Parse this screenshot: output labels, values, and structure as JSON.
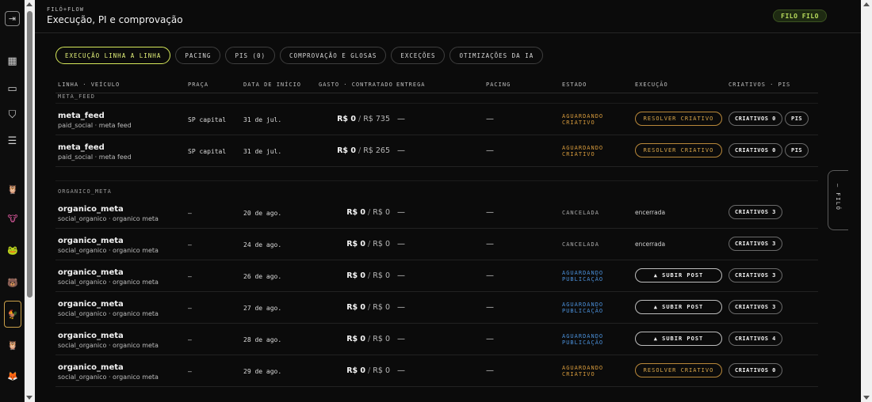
{
  "sidebar": {
    "toggle_icon": "panel-toggle-icon",
    "nav": [
      {
        "name": "grid-icon",
        "glyph": "▦"
      },
      {
        "name": "folder-icon",
        "glyph": "▭"
      },
      {
        "name": "shield-icon",
        "glyph": "⛉"
      },
      {
        "name": "list-icon",
        "glyph": "☰"
      }
    ],
    "avatars": [
      {
        "name": "owl-avatar-purple",
        "glyph": "🦉",
        "color": "#7a5de0"
      },
      {
        "name": "cow-avatar",
        "glyph": "🐮",
        "color": "#e05aa0"
      },
      {
        "name": "frog-avatar",
        "glyph": "🐸",
        "color": "#2aa160"
      },
      {
        "name": "bear-avatar",
        "glyph": "🐻",
        "color": "#d9452e"
      },
      {
        "name": "rooster-avatar",
        "glyph": "🐓",
        "color": "#e0533a"
      },
      {
        "name": "owl-avatar-blue",
        "glyph": "🦉",
        "color": "#3a8ad9"
      },
      {
        "name": "fox-avatar",
        "glyph": "🦊",
        "color": "#d98a2e"
      }
    ]
  },
  "header": {
    "brand": "FILÓ+FLOW",
    "title": "Execução, PI e comprovação",
    "user": "FILO FILO"
  },
  "tabs": [
    {
      "label": "EXECUÇÃO LINHA A LINHA",
      "active": true
    },
    {
      "label": "PACING",
      "active": false
    },
    {
      "label": "PIS (0)",
      "active": false
    },
    {
      "label": "COMPROVAÇÃO E GLOSAS",
      "active": false
    },
    {
      "label": "EXCEÇÕES",
      "active": false
    },
    {
      "label": "OTIMIZAÇÕES DA IA",
      "active": false
    }
  ],
  "columns": {
    "linha": "LINHA · VEÍCULO",
    "praca": "PRAÇA",
    "inicio": "DATA DE INÍCIO",
    "gasto": "GASTO · CONTRATADO",
    "entrega": "ENTREGA",
    "pacing": "PACING",
    "estado": "ESTADO",
    "execucao": "EXECUÇÃO",
    "criativos": "CRIATIVOS · PIS"
  },
  "groups": [
    {
      "label": "META_FEED",
      "rows": [
        {
          "name": "meta_feed",
          "sub": "paid_social · meta feed",
          "praca": "SP capital",
          "inicio": "31 de jul.",
          "gasto": "R$ 0",
          "contratado": "R$ 735",
          "entrega": "—",
          "pacing": "—",
          "estado": [
            "AGUARDANDO",
            "CRIATIVO"
          ],
          "estado_tone": "orange",
          "exec_type": "button-orange",
          "exec": "RESOLVER CRIATIVO",
          "criativos": "CRIATIVOS 0",
          "pis": "PIS"
        },
        {
          "name": "meta_feed",
          "sub": "paid_social · meta feed",
          "praca": "SP capital",
          "inicio": "31 de jul.",
          "gasto": "R$ 0",
          "contratado": "R$ 265",
          "entrega": "—",
          "pacing": "—",
          "estado": [
            "AGUARDANDO",
            "CRIATIVO"
          ],
          "estado_tone": "orange",
          "exec_type": "button-orange",
          "exec": "RESOLVER CRIATIVO",
          "criativos": "CRIATIVOS 0",
          "pis": "PIS"
        }
      ]
    },
    {
      "label": "ORGANICO_META",
      "rows": [
        {
          "name": "organico_meta",
          "sub": "social_organico · organico meta",
          "praca": "—",
          "inicio": "20 de ago.",
          "gasto": "R$ 0",
          "contratado": "R$ 0",
          "entrega": "—",
          "pacing": "—",
          "estado": [
            "CANCELADA"
          ],
          "estado_tone": "grey",
          "exec_type": "text",
          "exec": "encerrada",
          "criativos": "CRIATIVOS 3",
          "pis": ""
        },
        {
          "name": "organico_meta",
          "sub": "social_organico · organico meta",
          "praca": "—",
          "inicio": "24 de ago.",
          "gasto": "R$ 0",
          "contratado": "R$ 0",
          "entrega": "—",
          "pacing": "—",
          "estado": [
            "CANCELADA"
          ],
          "estado_tone": "grey",
          "exec_type": "text",
          "exec": "encerrada",
          "criativos": "CRIATIVOS 3",
          "pis": ""
        },
        {
          "name": "organico_meta",
          "sub": "social_organico · organico meta",
          "praca": "—",
          "inicio": "26 de ago.",
          "gasto": "R$ 0",
          "contratado": "R$ 0",
          "entrega": "—",
          "pacing": "—",
          "estado": [
            "AGUARDANDO",
            "PUBLICAÇÃO"
          ],
          "estado_tone": "blue",
          "exec_type": "button-white",
          "exec": "▲ SUBIR POST",
          "criativos": "CRIATIVOS 3",
          "pis": ""
        },
        {
          "name": "organico_meta",
          "sub": "social_organico · organico meta",
          "praca": "—",
          "inicio": "27 de ago.",
          "gasto": "R$ 0",
          "contratado": "R$ 0",
          "entrega": "—",
          "pacing": "—",
          "estado": [
            "AGUARDANDO",
            "PUBLICAÇÃO"
          ],
          "estado_tone": "blue",
          "exec_type": "button-white",
          "exec": "▲ SUBIR POST",
          "criativos": "CRIATIVOS 3",
          "pis": ""
        },
        {
          "name": "organico_meta",
          "sub": "social_organico · organico meta",
          "praca": "—",
          "inicio": "28 de ago.",
          "gasto": "R$ 0",
          "contratado": "R$ 0",
          "entrega": "—",
          "pacing": "—",
          "estado": [
            "AGUARDANDO",
            "PUBLICAÇÃO"
          ],
          "estado_tone": "blue",
          "exec_type": "button-white",
          "exec": "▲ SUBIR POST",
          "criativos": "CRIATIVOS 4",
          "pis": ""
        },
        {
          "name": "organico_meta",
          "sub": "social_organico · organico meta",
          "praca": "—",
          "inicio": "29 de ago.",
          "gasto": "R$ 0",
          "contratado": "R$ 0",
          "entrega": "—",
          "pacing": "—",
          "estado": [
            "AGUARDANDO",
            "CRIATIVO"
          ],
          "estado_tone": "orange",
          "exec_type": "button-orange",
          "exec": "RESOLVER CRIATIVO",
          "criativos": "CRIATIVOS 0",
          "pis": ""
        }
      ]
    }
  ],
  "drawer_handle": {
    "label": "— FILÓ"
  }
}
